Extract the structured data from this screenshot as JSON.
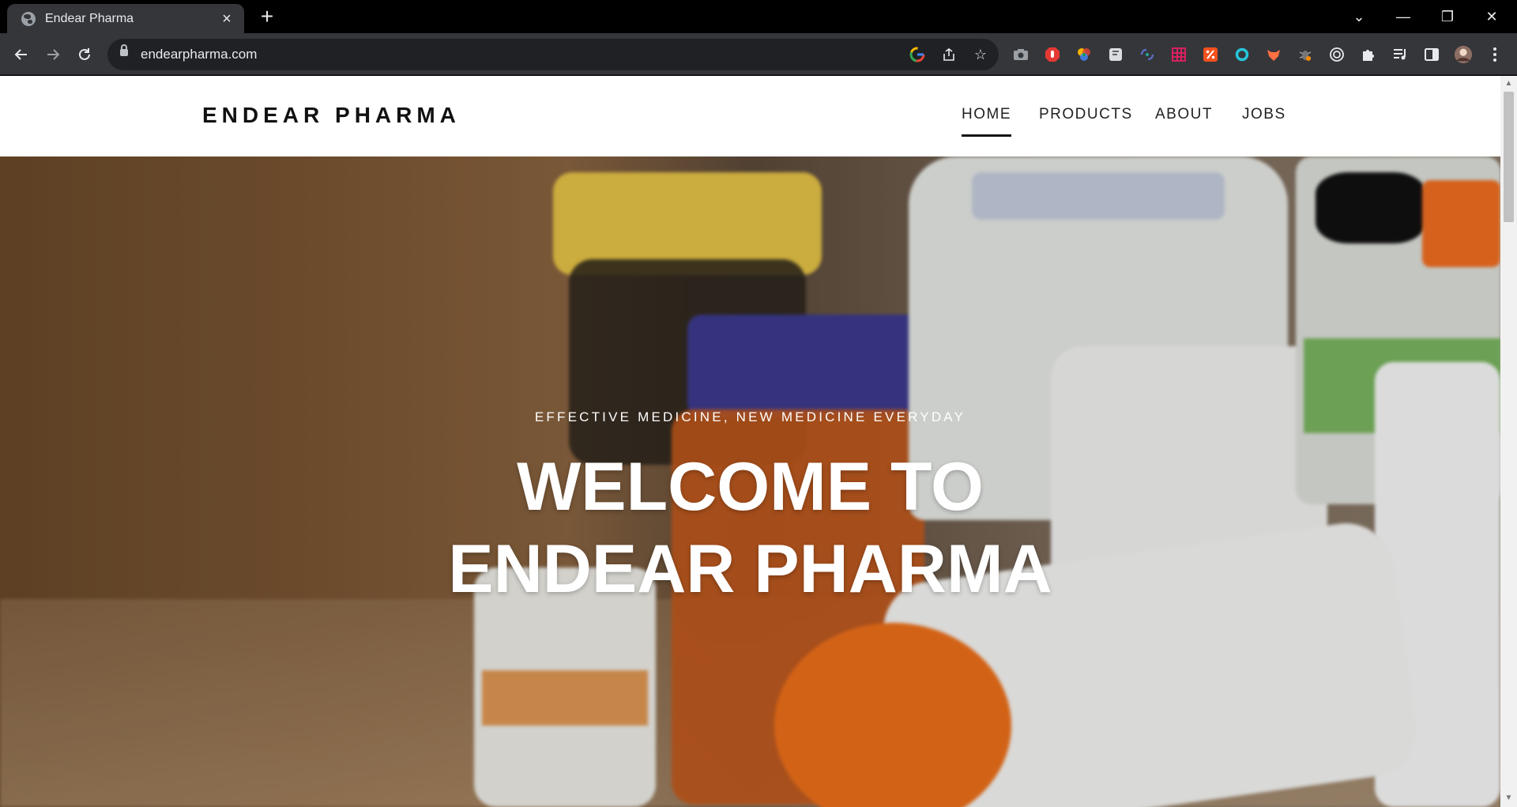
{
  "browser": {
    "tab_title": "Endear Pharma",
    "new_tab_symbol": "+",
    "url": "endearpharma.com",
    "window_controls": [
      "⌄",
      "—",
      "❐",
      "✕"
    ]
  },
  "site": {
    "brand": "ENDEAR PHARMA",
    "nav": [
      {
        "label": "HOME",
        "active": true
      },
      {
        "label": "PRODUCTS",
        "active": false
      },
      {
        "label": "ABOUT",
        "active": false
      },
      {
        "label": "JOBS",
        "active": false
      }
    ]
  },
  "hero": {
    "kicker": "EFFECTIVE MEDICINE, NEW MEDICINE EVERYDAY",
    "title_line1": "WELCOME TO",
    "title_line2": "ENDEAR PHARMA"
  },
  "colors": {
    "chrome_dark": "#000000",
    "toolbar": "#35363a",
    "omnibox": "#202124",
    "page_bg": "#ffffff",
    "text_dark": "#111111"
  }
}
